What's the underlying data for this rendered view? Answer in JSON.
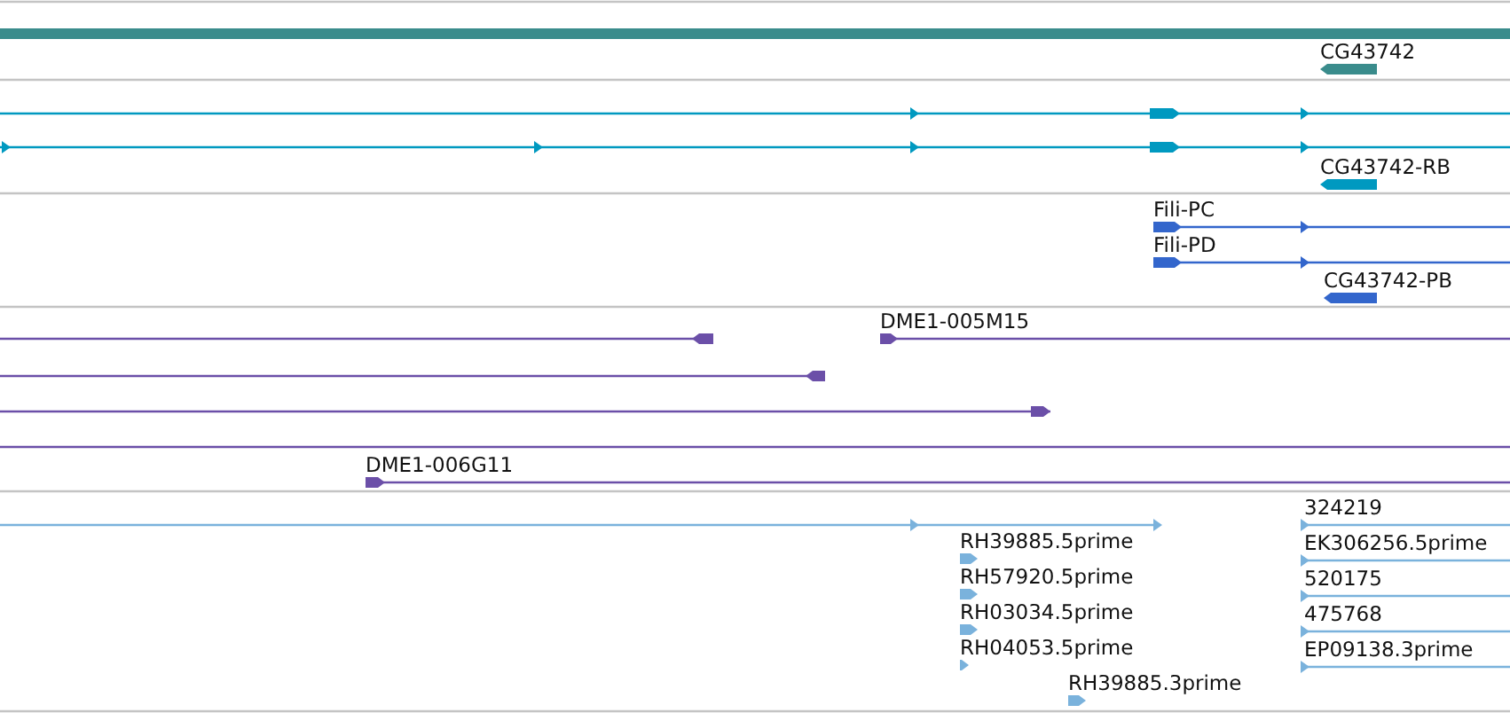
{
  "tracks": [
    {
      "color": "#3a8c8c",
      "features": [
        {
          "label": "CG43742"
        }
      ]
    },
    {
      "color": "#0099c0",
      "features": [
        {
          "label": "CG43742-RB"
        }
      ]
    },
    {
      "color": "#3366cc",
      "features": [
        {
          "label": "Fili-PC"
        },
        {
          "label": "Fili-PD"
        },
        {
          "label": "CG43742-PB"
        }
      ]
    },
    {
      "color": "#6b4fa8",
      "features": [
        {
          "label": "DME1-005M15"
        },
        {
          "label": "DME1-006G11"
        }
      ]
    },
    {
      "color": "#7ab2dc",
      "features": [
        {
          "label": "RH39885.5prime"
        },
        {
          "label": "RH57920.5prime"
        },
        {
          "label": "RH03034.5prime"
        },
        {
          "label": "RH04053.5prime"
        },
        {
          "label": "RH39885.3prime"
        },
        {
          "label": "324219"
        },
        {
          "label": "EK306256.5prime"
        },
        {
          "label": "520175"
        },
        {
          "label": "475768"
        },
        {
          "label": "EP09138.3prime"
        }
      ]
    }
  ]
}
